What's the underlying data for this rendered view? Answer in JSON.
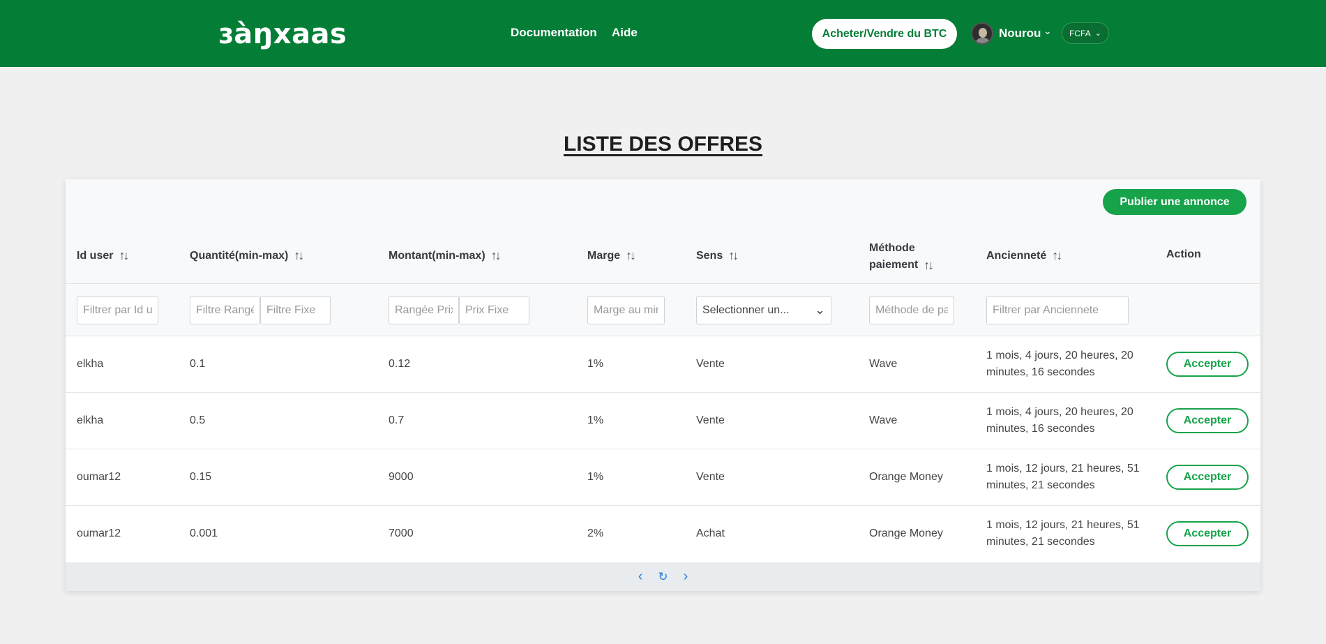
{
  "header": {
    "logo": "ɜàŋxaas",
    "nav": [
      "Documentation",
      "Aide"
    ],
    "buy_sell_btc": "Acheter/Vendre du BTC",
    "user_name": "Nourou",
    "currency": "FCFA"
  },
  "page_title": "LISTE DES OFFRES",
  "publish_button": "Publier une annonce",
  "columns": {
    "id_user": "Id user",
    "quantite": "Quantité(min-max)",
    "montant": "Montant(min-max)",
    "marge": "Marge",
    "sens": "Sens",
    "methode_line1": "Méthode",
    "methode_line2": "paiement",
    "anciennete": "Ancienneté",
    "action": "Action"
  },
  "filters": {
    "id_user": "Filtrer par Id user",
    "quantite_range": "Filtre Rangée",
    "quantite_fixe": "Filtre Fixe",
    "montant_range": "Rangée Prix",
    "montant_fixe": "Prix Fixe",
    "marge": "Marge au minimum",
    "sens": "Selectionner un...",
    "methode": "Méthode de paiement",
    "anciennete": "Filtrer par Anciennete"
  },
  "rows": [
    {
      "id_user": "elkha",
      "quantite": "0.1",
      "montant": "0.12",
      "marge": "1%",
      "sens": "Vente",
      "methode": "Wave",
      "anciennete_1": "1 mois, 4 jours, 20 heures, 20",
      "anciennete_2": "minutes, 16 secondes",
      "action": "Accepter"
    },
    {
      "id_user": "elkha",
      "quantite": "0.5",
      "montant": "0.7",
      "marge": "1%",
      "sens": "Vente",
      "methode": "Wave",
      "anciennete_1": "1 mois, 4 jours, 20 heures, 20",
      "anciennete_2": "minutes, 16 secondes",
      "action": "Accepter"
    },
    {
      "id_user": "oumar12",
      "quantite": "0.15",
      "montant": "9000",
      "marge": "1%",
      "sens": "Vente",
      "methode": "Orange Money",
      "anciennete_1": "1 mois, 12 jours, 21 heures, 51",
      "anciennete_2": "minutes, 21 secondes",
      "action": "Accepter"
    },
    {
      "id_user": "oumar12",
      "quantite": "0.001",
      "montant": "7000",
      "marge": "2%",
      "sens": "Achat",
      "methode": "Orange Money",
      "anciennete_1": "1 mois, 12 jours, 21 heures, 51",
      "anciennete_2": "minutes, 21 secondes",
      "action": "Accepter"
    }
  ],
  "colors": {
    "header_green": "#047e37",
    "accent_green": "#16a34a",
    "pager_blue": "#2b7de0"
  }
}
